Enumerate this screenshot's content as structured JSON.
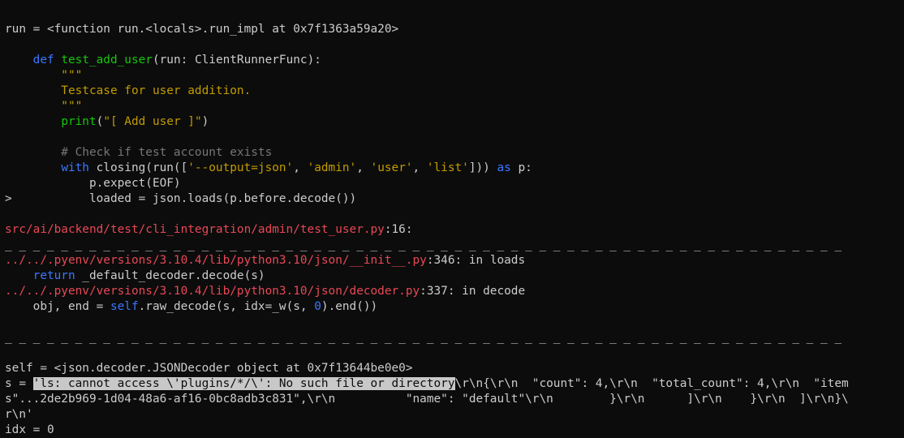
{
  "terminal": {
    "lines": [
      [],
      [
        {
          "text": "run = <function run.<locals>.run_impl at 0x7f1363a59a20>",
          "style": "default"
        }
      ],
      [],
      [
        {
          "text": "    ",
          "style": "default"
        },
        {
          "text": "def",
          "style": "kw"
        },
        {
          "text": " ",
          "style": "default"
        },
        {
          "text": "test_add_user",
          "style": "fn"
        },
        {
          "text": "(run: ClientRunnerFunc):",
          "style": "default"
        }
      ],
      [
        {
          "text": "        \"\"\"",
          "style": "str"
        }
      ],
      [
        {
          "text": "        Testcase for user addition.",
          "style": "str"
        }
      ],
      [
        {
          "text": "        \"\"\"",
          "style": "str"
        }
      ],
      [
        {
          "text": "        ",
          "style": "default"
        },
        {
          "text": "print",
          "style": "fn"
        },
        {
          "text": "(",
          "style": "default"
        },
        {
          "text": "\"[ Add user ]\"",
          "style": "str"
        },
        {
          "text": ")",
          "style": "default"
        }
      ],
      [],
      [
        {
          "text": "        # Check if test account exists",
          "style": "comment"
        }
      ],
      [
        {
          "text": "        ",
          "style": "default"
        },
        {
          "text": "with",
          "style": "kw"
        },
        {
          "text": " closing(run([",
          "style": "default"
        },
        {
          "text": "'--output=json'",
          "style": "str"
        },
        {
          "text": ", ",
          "style": "default"
        },
        {
          "text": "'admin'",
          "style": "str"
        },
        {
          "text": ", ",
          "style": "default"
        },
        {
          "text": "'user'",
          "style": "str"
        },
        {
          "text": ", ",
          "style": "default"
        },
        {
          "text": "'list'",
          "style": "str"
        },
        {
          "text": "])) ",
          "style": "default"
        },
        {
          "text": "as",
          "style": "kw"
        },
        {
          "text": " p:",
          "style": "default"
        }
      ],
      [
        {
          "text": "            p.expect(EOF)",
          "style": "default"
        }
      ],
      [
        {
          "text": ">           loaded = json.loads(p.before.decode())",
          "style": "default"
        }
      ],
      [],
      [
        {
          "text": "src/ai/backend/test/cli_integration/admin/test_user.py",
          "style": "err"
        },
        {
          "text": ":16:",
          "style": "default"
        }
      ],
      [
        {
          "text": "_ _ _ _ _ _ _ _ _ _ _ _ _ _ _ _ _ _ _ _ _ _ _ _ _ _ _ _ _ _ _ _ _ _ _ _ _ _ _ _ _ _ _ _ _ _ _ _ _ _ _ _ _ _ _ _ _ _ _ _",
          "style": "default"
        }
      ],
      [
        {
          "text": "../../.pyenv/versions/3.10.4/lib/python3.10/json/__init__.py",
          "style": "err"
        },
        {
          "text": ":346: in loads",
          "style": "default"
        }
      ],
      [
        {
          "text": "    ",
          "style": "default"
        },
        {
          "text": "return",
          "style": "kw"
        },
        {
          "text": " _default_decoder.decode(s)",
          "style": "default"
        }
      ],
      [
        {
          "text": "../../.pyenv/versions/3.10.4/lib/python3.10/json/decoder.py",
          "style": "err"
        },
        {
          "text": ":337: in decode",
          "style": "default"
        }
      ],
      [
        {
          "text": "    obj, end = ",
          "style": "default"
        },
        {
          "text": "self",
          "style": "kw"
        },
        {
          "text": ".raw_decode(s, idx=_w(s, ",
          "style": "default"
        },
        {
          "text": "0",
          "style": "num"
        },
        {
          "text": ").end())",
          "style": "default"
        }
      ],
      [],
      [
        {
          "text": "_ _ _ _ _ _ _ _ _ _ _ _ _ _ _ _ _ _ _ _ _ _ _ _ _ _ _ _ _ _ _ _ _ _ _ _ _ _ _ _ _ _ _ _ _ _ _ _ _ _ _ _ _ _ _ _ _ _ _ _",
          "style": "default"
        }
      ],
      [],
      [
        {
          "text": "self = <json.decoder.JSONDecoder object at 0x7f13644be0e0>",
          "style": "default"
        }
      ],
      [
        {
          "text": "s = ",
          "style": "default"
        },
        {
          "text": "'ls: cannot access \\'plugins/*/\\': No such file or directory",
          "style": "hl"
        },
        {
          "text": "\\r\\n{\\r\\n  \"count\": 4,\\r\\n  \"total_count\": 4,\\r\\n  \"item",
          "style": "default"
        }
      ],
      [
        {
          "text": "s\"...2de2b969-1d04-48a6-af16-0bc8adb3c831\",\\r\\n          \"name\": \"default\"\\r\\n        }\\r\\n      ]\\r\\n    }\\r\\n  ]\\r\\n}\\",
          "style": "default"
        }
      ],
      [
        {
          "text": "r\\n'",
          "style": "default"
        }
      ],
      [
        {
          "text": "idx = 0",
          "style": "default"
        }
      ]
    ]
  }
}
